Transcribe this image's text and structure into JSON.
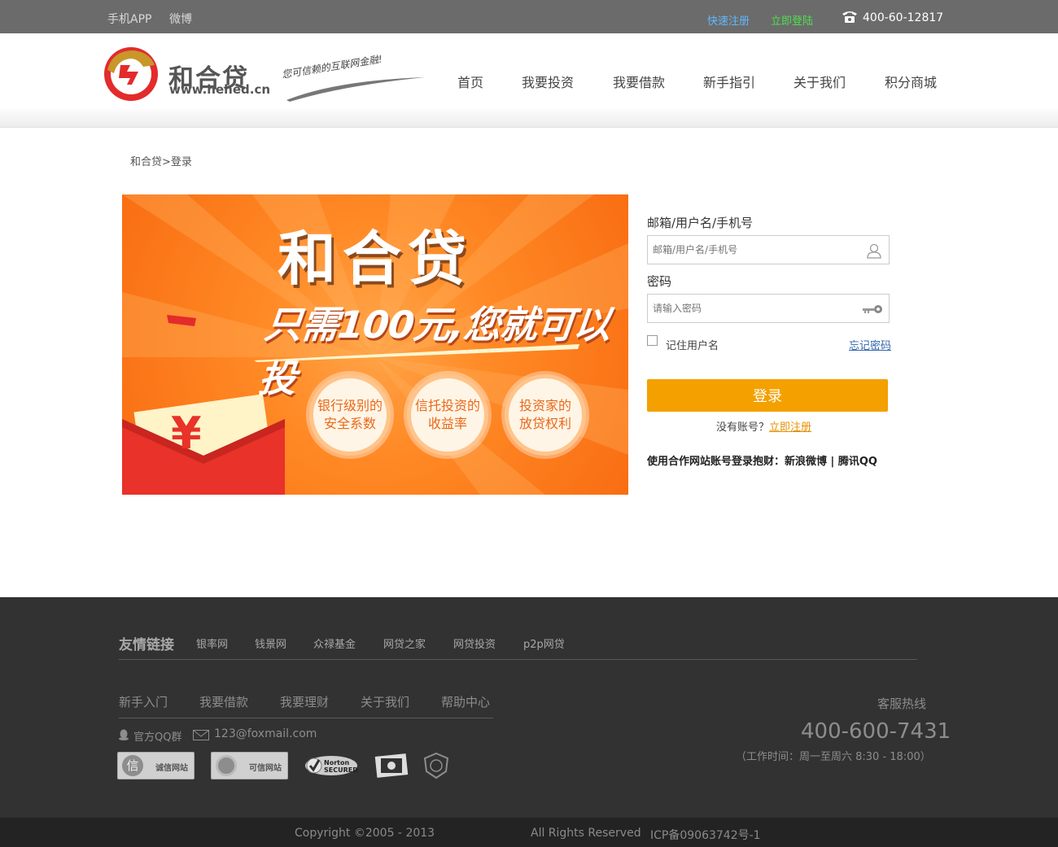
{
  "topbar": {
    "mobile_app": "手机APP",
    "weibo": "微博",
    "quick_register": "快速注册",
    "login_now": "立即登陆",
    "phone": "400-60-12817"
  },
  "header": {
    "logo_name": "和合贷",
    "logo_url": "www.hehed.cn",
    "slogan": "您可信赖的互联网金融!",
    "nav": [
      "首页",
      "我要投资",
      "我要借款",
      "新手指引",
      "关于我们",
      "积分商城"
    ]
  },
  "breadcrumb": "和合贷>登录",
  "banner": {
    "title": "和合贷",
    "slogan": "只需100元,您就可以投",
    "features": [
      {
        "line1": "银行级别的",
        "line2": "安全系数"
      },
      {
        "line1": "信托投资的",
        "line2": "收益率"
      },
      {
        "line1": "投资家的",
        "line2": "放贷权利"
      }
    ],
    "currency_symbol": "¥"
  },
  "login": {
    "username_label": "邮箱/用户名/手机号",
    "username_placeholder": "邮箱/用户名/手机号",
    "password_label": "密码",
    "password_placeholder": "请输入密码",
    "remember_label": "记住用户名",
    "forgot_label": "忘记密码",
    "submit_label": "登录",
    "no_account": "没有账号？",
    "register_now": "立即注册",
    "partner_prefix": "使用合作网站账号登录抱财：",
    "partner_weibo": "新浪微博",
    "partner_sep": " | ",
    "partner_qq": "腾讯QQ"
  },
  "footer": {
    "friend_links_title": "友情链接",
    "friend_links": [
      "银率网",
      "钱景网",
      "众禄基金",
      "网贷之家",
      "网贷投资",
      "p2p网贷"
    ],
    "nav": [
      "新手入门",
      "我要借款",
      "我要理财",
      "关于我们",
      "帮助中心"
    ],
    "qq_group": "官方QQ群",
    "email": "123@foxmail.com",
    "badges": [
      "诚信网站",
      "可信网站",
      "Norton SECURED"
    ],
    "hotline_label": "客服热线",
    "hotline": "400-600-7431",
    "hours": "（工作时间：周一至周六 8:30 - 18:00）",
    "copyright": "Copyright ©2005 - 2013",
    "rights": "All Rights Reserved",
    "icp": "ICP备09063742号-1"
  },
  "colors": {
    "accent_orange": "#f4a000",
    "banner_orange": "#f96d12",
    "brand_red": "#e32b2b",
    "footer_bg": "#323232"
  }
}
